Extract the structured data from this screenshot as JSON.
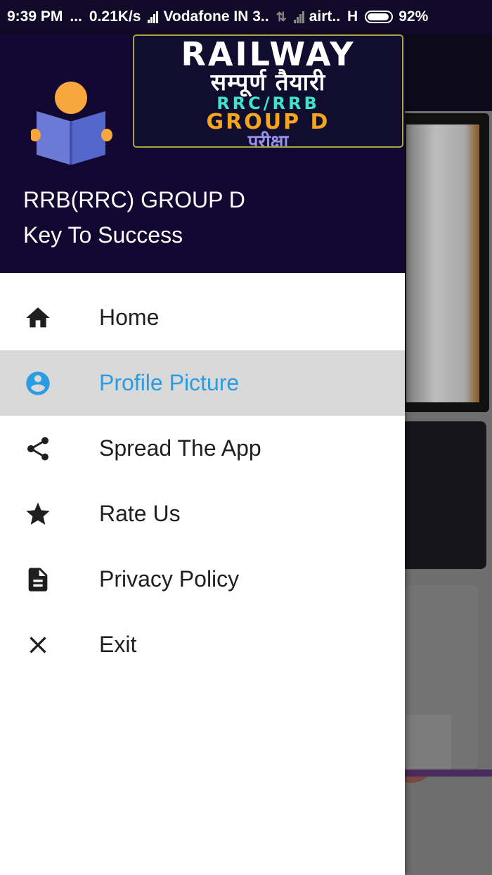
{
  "status_bar": {
    "time": "9:39 PM",
    "dots": "...",
    "speed": "0.21K/s",
    "carrier1": "Vodafone IN 3..",
    "carrier2": "airt..",
    "network_type": "H",
    "battery": "92%"
  },
  "drawer": {
    "banner": {
      "line1": "RAILWAY",
      "line2": "सम्पूर्ण तैयारी",
      "line3": "RRC/RRB",
      "line4": "GROUP D",
      "line5": "परीक्षा"
    },
    "title": "RRB(RRC) GROUP D",
    "subtitle": "Key To Success",
    "menu": [
      {
        "label": "Home",
        "icon": "home-icon"
      },
      {
        "label": "Profile Picture",
        "icon": "account-circle-icon",
        "selected": true
      },
      {
        "label": "Spread The App",
        "icon": "share-icon"
      },
      {
        "label": "Rate Us",
        "icon": "star-icon"
      },
      {
        "label": "Privacy Policy",
        "icon": "document-icon"
      },
      {
        "label": "Exit",
        "icon": "close-icon"
      }
    ]
  },
  "colors": {
    "header_bg": "#120731",
    "selected_bg": "#d9d9d9",
    "accent": "#2c9ce2",
    "text": "#1f1f1f"
  }
}
